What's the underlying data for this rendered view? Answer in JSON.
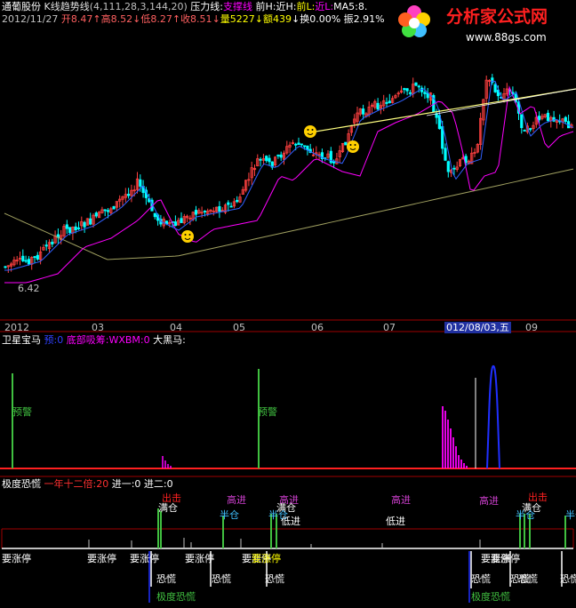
{
  "header": {
    "stock_name": "通葡股份",
    "indicator_name": "K线趋势线",
    "indicator_params": "(4,111,28,3,144,20)",
    "pressure_label": "压力线:",
    "support_label": "支撑线",
    "prev_high_label": "前H:",
    "near_high_label": "近H:",
    "prev_low_label": "前L:",
    "near_low_label": "近L:",
    "ma_label": "MA5:8.",
    "date": "2012/11/27",
    "open": "开8.47",
    "high": "高8.52",
    "low": "低8.27",
    "close": "收8.51",
    "volume": "量5227",
    "amount": "额439",
    "turnover": "换0.00%",
    "amplitude": "振2.91%"
  },
  "logo": {
    "text": "分析家公式网",
    "url_text": "www.88gs.com"
  },
  "axis": {
    "ticks": [
      "2012",
      "03",
      "04",
      "05",
      "06",
      "07",
      "09"
    ],
    "cursor_label": "012/08/03,五",
    "low_marker": "6.42"
  },
  "panel2": {
    "title": "卫星宝马",
    "p1": "预:0",
    "p2": "底部吸筹:",
    "p3": "WXBM:0",
    "p4": "大黑马:",
    "warn_label": "预警"
  },
  "panel3": {
    "title": "极度恐慌",
    "p1": "一年十二倍:20",
    "p2": "进一:0",
    "p3": "进二:0",
    "labels": {
      "full": "满仓",
      "half": "半仓",
      "low_in": "低进",
      "high_in": "高进",
      "out": "出击",
      "limit_up": "要涨停",
      "panic": "恐慌",
      "extreme_panic": "极度恐慌"
    }
  },
  "colors": {
    "up": "#ff4040",
    "down": "#00ffff",
    "ma_magenta": "#ff00ff",
    "ma_blue": "#3060ff",
    "ma_yellow": "#ffff80",
    "ma_olive": "#a0a060",
    "green": "#40c040",
    "frame": "#a00000"
  },
  "chart_data": {
    "type": "candlestick",
    "x_axis_ticks": [
      "2012",
      "03",
      "04",
      "05",
      "06",
      "07",
      "09"
    ],
    "y_min_marker": 6.42,
    "last_bar": {
      "date": "2012/11/27",
      "open": 8.47,
      "high": 8.52,
      "low": 8.27,
      "close": 8.51,
      "volume": 5227,
      "amount": 439,
      "turnover_pct": 0.0,
      "amplitude_pct": 2.91
    }
  }
}
